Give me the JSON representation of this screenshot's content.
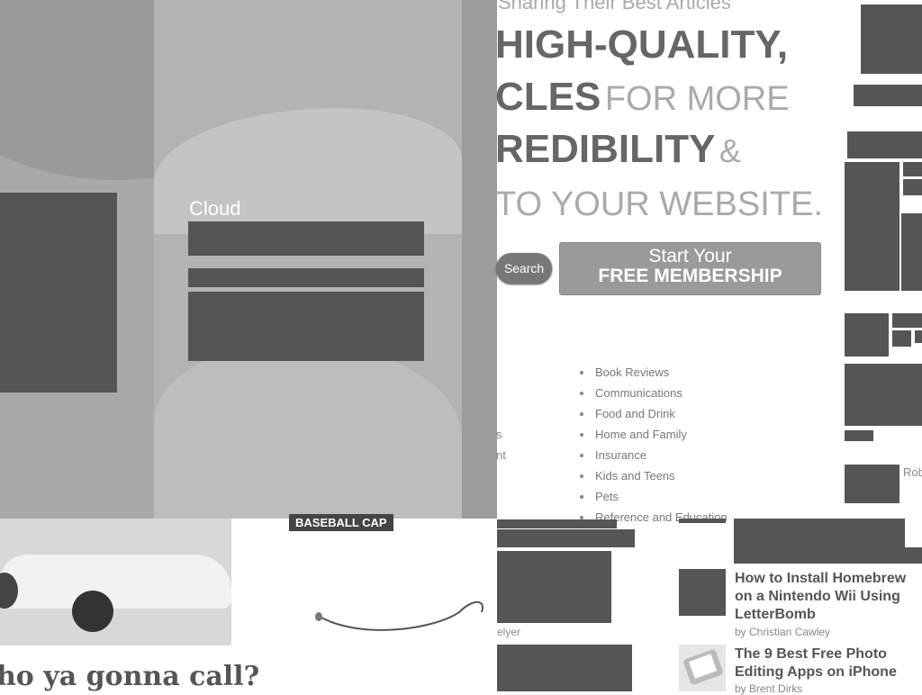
{
  "wallpaper": {
    "label": "Cloud"
  },
  "hero": {
    "tagline": "Sharing Their Best Articles",
    "line1": "HIGH-QUALITY,",
    "line2_bold": "CLES",
    "line2_light": "FOR MORE",
    "line3_bold": "REDIBILITY",
    "line3_light": "&",
    "line4": "TO YOUR WEBSITE."
  },
  "search_button": "Search",
  "membership_button": {
    "line1": "Start Your",
    "line2": "FREE MEMBERSHIP"
  },
  "categories": [
    "Book Reviews",
    "Communications",
    "Food and Drink",
    "Home and Family",
    "Insurance",
    "Kids and Teens",
    "Pets",
    "Reference and Education"
  ],
  "category_fragments": [
    "s",
    "nt"
  ],
  "bottom": {
    "headline": "ho ya gonna call?",
    "cap_label": "BASEBALL CAP",
    "author_fragment": "elyer",
    "side_author_fragment": "Rob"
  },
  "articles": [
    {
      "title": "How to Install Homebrew on a Nintendo Wii Using LetterBomb",
      "byline": "by Christian Cawley"
    },
    {
      "title": "The 9 Best Free Photo Editing Apps on iPhone",
      "byline": "by Brent Dirks"
    }
  ]
}
